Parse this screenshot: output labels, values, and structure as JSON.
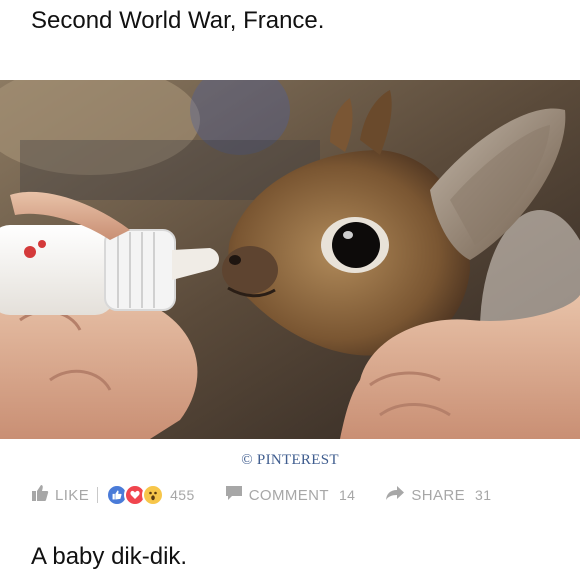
{
  "post": {
    "title": "Second World War, France.",
    "image_alt": "A baby dik-dik being bottle fed",
    "credit": "© PINTEREST",
    "caption": "A baby dik-dik."
  },
  "actions": {
    "like_label": "LIKE",
    "reaction_count": "455",
    "comment_label": "COMMENT",
    "comment_count": "14",
    "share_label": "SHARE",
    "share_count": "31",
    "reactions": [
      "like-reaction-icon",
      "love-reaction-icon",
      "wow-reaction-icon"
    ]
  },
  "colors": {
    "credit": "#3f5d8f",
    "action_gray": "#a7a7a7",
    "like_blue": "#4a7bd8",
    "love_red": "#f0454e",
    "wow_yellow": "#f7c64a"
  }
}
